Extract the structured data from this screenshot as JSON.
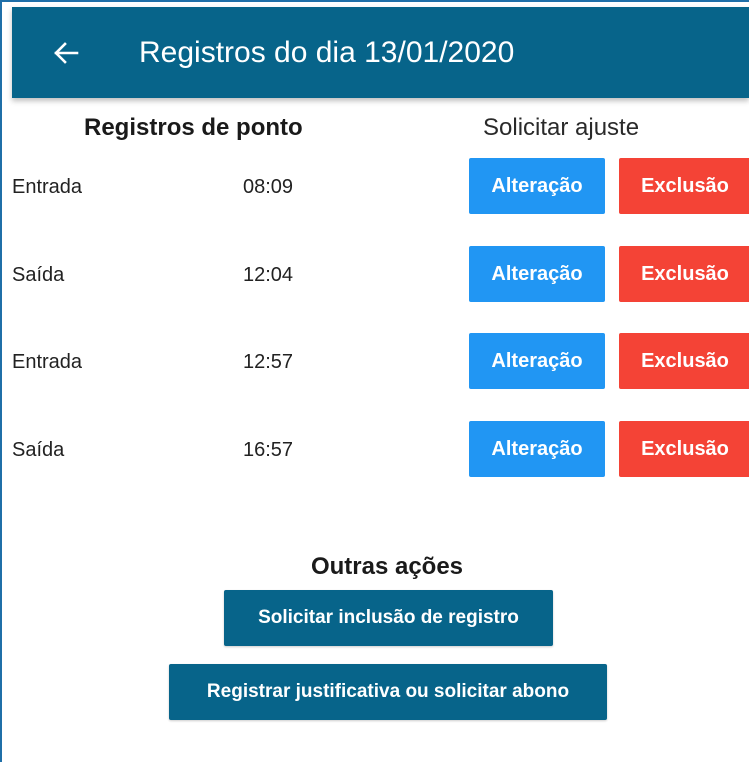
{
  "appbar": {
    "title": "Registros do dia 13/01/2020",
    "back_icon": "arrow-back-icon"
  },
  "headers": {
    "records": "Registros de ponto",
    "adjust": "Solicitar ajuste"
  },
  "records": [
    {
      "type": "Entrada",
      "time": "08:09"
    },
    {
      "type": "Saída",
      "time": "12:04"
    },
    {
      "type": "Entrada",
      "time": "12:57"
    },
    {
      "type": "Saída",
      "time": "16:57"
    }
  ],
  "buttons": {
    "change": "Alteração",
    "delete": "Exclusão"
  },
  "other_actions": {
    "title": "Outras ações",
    "request_inclusion": "Solicitar inclusão de registro",
    "justify": "Registrar justificativa ou solicitar abono"
  },
  "colors": {
    "primary": "#07648a",
    "change_button": "#2196f3",
    "delete_button": "#f44336"
  }
}
